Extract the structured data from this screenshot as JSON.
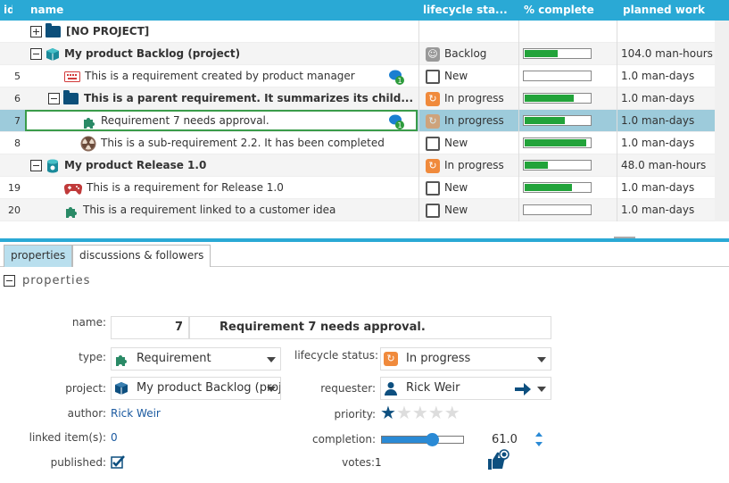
{
  "grid": {
    "headers": {
      "id": "id",
      "name": "name",
      "lifecycle": "lifecycle sta...",
      "complete": "% complete",
      "planned": "planned work"
    },
    "rows": [
      {
        "id": "",
        "name": "[NO PROJECT]",
        "status": "",
        "pct": null,
        "planned": ""
      },
      {
        "id": "",
        "name": "My product Backlog (project)",
        "status": "Backlog",
        "pct": 50,
        "planned": "104.0 man-hours"
      },
      {
        "id": "5",
        "name": "This is a requirement created by product manager",
        "status": "New",
        "pct": 0,
        "planned": "1.0 man-days",
        "badge": "1"
      },
      {
        "id": "6",
        "name": "This is a parent requirement. It summarizes its child...",
        "status": "In progress",
        "pct": 75,
        "planned": "1.0 man-days"
      },
      {
        "id": "7",
        "name": "Requirement 7 needs approval.",
        "status": "In progress",
        "pct": 61,
        "planned": "1.0 man-days",
        "badge": "1"
      },
      {
        "id": "8",
        "name": "This is a sub-requirement 2.2. It has been completed",
        "status": "New",
        "pct": 95,
        "planned": "1.0 man-days"
      },
      {
        "id": "",
        "name": "My product Release 1.0",
        "status": "In progress",
        "pct": 35,
        "planned": "48.0 man-hours"
      },
      {
        "id": "19",
        "name": "This is a requirement for Release 1.0",
        "status": "New",
        "pct": 72,
        "planned": "1.0 man-days"
      },
      {
        "id": "20",
        "name": "This is a requirement linked to a customer idea",
        "status": "New",
        "pct": 0,
        "planned": "1.0 man-days"
      }
    ]
  },
  "tabs": {
    "properties": "properties",
    "discussions": "discussions & followers"
  },
  "section": {
    "title": "properties"
  },
  "form": {
    "name_label": "name:",
    "id_value": "7",
    "name_value": "Requirement 7 needs approval.",
    "type_label": "type:",
    "type_value": "Requirement",
    "lifecycle_label": "lifecycle status:",
    "lifecycle_value": "In progress",
    "project_label": "project:",
    "project_value": "My product Backlog (proj",
    "requester_label": "requester:",
    "requester_value": "Rick Weir",
    "author_label": "author:",
    "author_value": "Rick Weir",
    "priority_label": "priority:",
    "priority_stars": 1,
    "priority_max": 5,
    "linked_label": "linked item(s):",
    "linked_value": "0",
    "completion_label": "completion:",
    "completion_value": "61.0",
    "completion_fraction": 0.61,
    "published_label": "published:",
    "votes_label": "votes:",
    "votes_value": "1"
  },
  "colors": {
    "header": "#2aa9d5",
    "selected_row": "#9dcbdb",
    "progress": "#22a33a",
    "inprogress": "#f08a3c",
    "accent": "#0d4f7f"
  }
}
